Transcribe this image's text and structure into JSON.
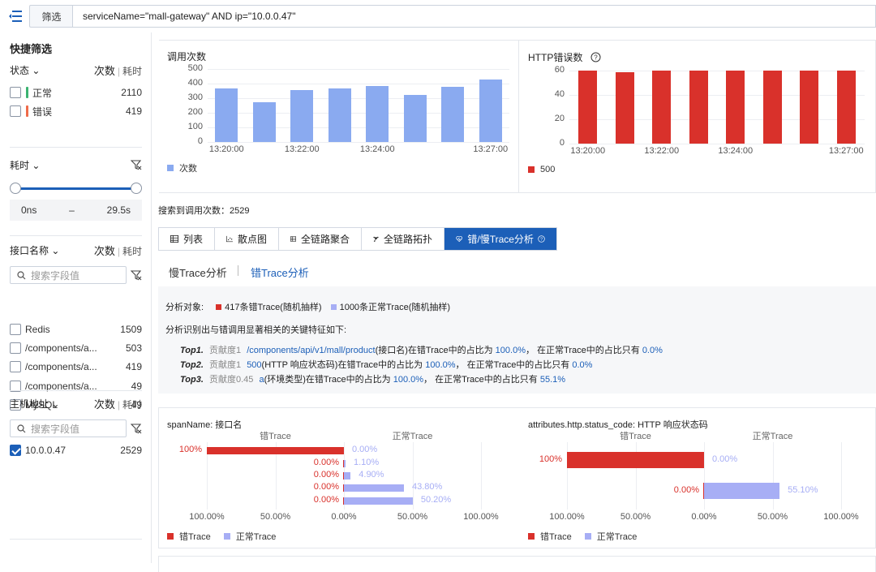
{
  "topbar": {
    "filter_label": "筛选",
    "query": "serviceName=\"mall-gateway\" AND ip=\"10.0.0.47\""
  },
  "sidebar": {
    "title": "快捷筛选",
    "status": {
      "label": "状态",
      "count_label": "次数",
      "time_label": "耗时",
      "items": [
        {
          "label": "正常",
          "count": "2110",
          "color": "#3cb371"
        },
        {
          "label": "错误",
          "count": "419",
          "color": "#ef6b4a"
        }
      ]
    },
    "duration": {
      "label": "耗时",
      "min": "0ns",
      "dash": "–",
      "max": "29.5s"
    },
    "interface": {
      "label": "接口名称",
      "count_label": "次数",
      "time_label": "耗时",
      "search_placeholder": "搜索字段值",
      "items": [
        {
          "label": "Redis",
          "count": "1509",
          "bar": 0.56
        },
        {
          "label": "/components/a...",
          "count": "503",
          "bar": 0.19
        },
        {
          "label": "/components/a...",
          "count": "419",
          "bar": 0.16
        },
        {
          "label": "/components/a...",
          "count": "49",
          "bar": 0.02
        },
        {
          "label": "MySQL",
          "count": "49",
          "bar": 0.02
        }
      ]
    },
    "host": {
      "label": "主机地址",
      "count_label": "次数",
      "time_label": "耗时",
      "search_placeholder": "搜索字段值",
      "items": [
        {
          "label": "10.0.0.47",
          "count": "2529",
          "bar": 1.0
        }
      ]
    }
  },
  "calls_chart": {
    "title": "调用次数",
    "legend": "次数"
  },
  "errors_chart": {
    "title": "HTTP错误数",
    "legend": "500"
  },
  "search_count": "搜索到调用次数：2529",
  "tabs": [
    "列表",
    "散点图",
    "全链路聚合",
    "全链路拓扑",
    "错/慢Trace分析"
  ],
  "subtabs": {
    "slow": "慢Trace分析",
    "error": "错Trace分析"
  },
  "analysis": {
    "target_label": "分析对象:",
    "legend_error": "417条错Trace(随机抽样)",
    "legend_normal": "1000条正常Trace(随机抽样)",
    "intro": "分析识别出与错调用显著相关的关键特征如下:",
    "tops": [
      {
        "rank": "Top1.",
        "contrib": "贡献度1",
        "key": "/components/api/v1/mall/product",
        "desc": "(接口名)在错Trace中的占比为",
        "err": "100.0%",
        "mid": "，  在正常Trace中的占比只有",
        "norm": "0.0%"
      },
      {
        "rank": "Top2.",
        "contrib": "贡献度1",
        "key": "500",
        "desc": "(HTTP 响应状态码)在错Trace中的占比为",
        "err": "100.0%",
        "mid": "，  在正常Trace中的占比只有",
        "norm": "0.0%"
      },
      {
        "rank": "Top3.",
        "contrib": "贡献度0.45",
        "key": "a",
        "desc": "(环境类型)在错Trace中的占比为",
        "err": "100.0%",
        "mid": "，  在正常Trace中的占比只有",
        "norm": "55.1%"
      }
    ]
  },
  "colors": {
    "accent": "#1c5fb8",
    "error": "#d9312b",
    "normal": "#a7aef5",
    "calls": "#8aaaf0"
  },
  "chart_data": [
    {
      "type": "bar",
      "title": "调用次数",
      "categories": [
        "13:20:00",
        "13:21:00",
        "13:22:00",
        "13:23:00",
        "13:24:00",
        "13:25:00",
        "13:26:00",
        "13:27:00"
      ],
      "tick_labels": [
        "13:20:00",
        "13:22:00",
        "13:24:00",
        "13:27:00"
      ],
      "series": [
        {
          "name": "次数",
          "values": [
            365,
            275,
            355,
            365,
            385,
            325,
            380,
            430
          ]
        }
      ],
      "ylim": [
        0,
        500
      ],
      "yticks": [
        0,
        100,
        200,
        300,
        400,
        500
      ],
      "legend": "bottom-left"
    },
    {
      "type": "bar",
      "title": "HTTP错误数",
      "categories": [
        "13:20:00",
        "13:21:00",
        "13:22:00",
        "13:23:00",
        "13:24:00",
        "13:25:00",
        "13:26:00",
        "13:27:00"
      ],
      "tick_labels": [
        "13:20:00",
        "13:22:00",
        "13:24:00",
        "13:27:00"
      ],
      "series": [
        {
          "name": "500",
          "values": [
            60,
            59,
            60,
            60,
            60,
            60,
            60,
            60
          ]
        }
      ],
      "ylim": [
        0,
        60
      ],
      "yticks": [
        0,
        20,
        40,
        60
      ],
      "legend": "bottom-left"
    },
    {
      "type": "bar",
      "title": "spanName: 接口名",
      "left_header": "错Trace",
      "right_header": "正常Trace",
      "axis_labels": [
        "100.00%",
        "50.00%",
        "0.00%",
        "50.00%",
        "100.00%"
      ],
      "rows": [
        {
          "error": 100,
          "error_label": "100%",
          "normal": 0,
          "normal_label": "0.00%"
        },
        {
          "error": 0,
          "error_label": "0.00%",
          "normal": 1.1,
          "normal_label": "1.10%"
        },
        {
          "error": 0,
          "error_label": "0.00%",
          "normal": 4.9,
          "normal_label": "4.90%"
        },
        {
          "error": 0,
          "error_label": "0.00%",
          "normal": 43.8,
          "normal_label": "43.80%"
        },
        {
          "error": 0,
          "error_label": "0.00%",
          "normal": 50.2,
          "normal_label": "50.20%"
        }
      ],
      "series": [
        {
          "name": "错Trace"
        },
        {
          "name": "正常Trace"
        }
      ],
      "legend": "bottom-left"
    },
    {
      "type": "bar",
      "title": "attributes.http.status_code: HTTP 响应状态码",
      "left_header": "错Trace",
      "right_header": "正常Trace",
      "axis_labels": [
        "100.00%",
        "50.00%",
        "0.00%",
        "50.00%",
        "100.00%"
      ],
      "rows": [
        {
          "error": 100,
          "error_label": "100%",
          "normal": 0,
          "normal_label": "0.00%"
        },
        {
          "error": 0,
          "error_label": "0.00%",
          "normal": 55.1,
          "normal_label": "55.10%"
        }
      ],
      "series": [
        {
          "name": "错Trace"
        },
        {
          "name": "正常Trace"
        }
      ],
      "legend": "bottom-left"
    }
  ]
}
